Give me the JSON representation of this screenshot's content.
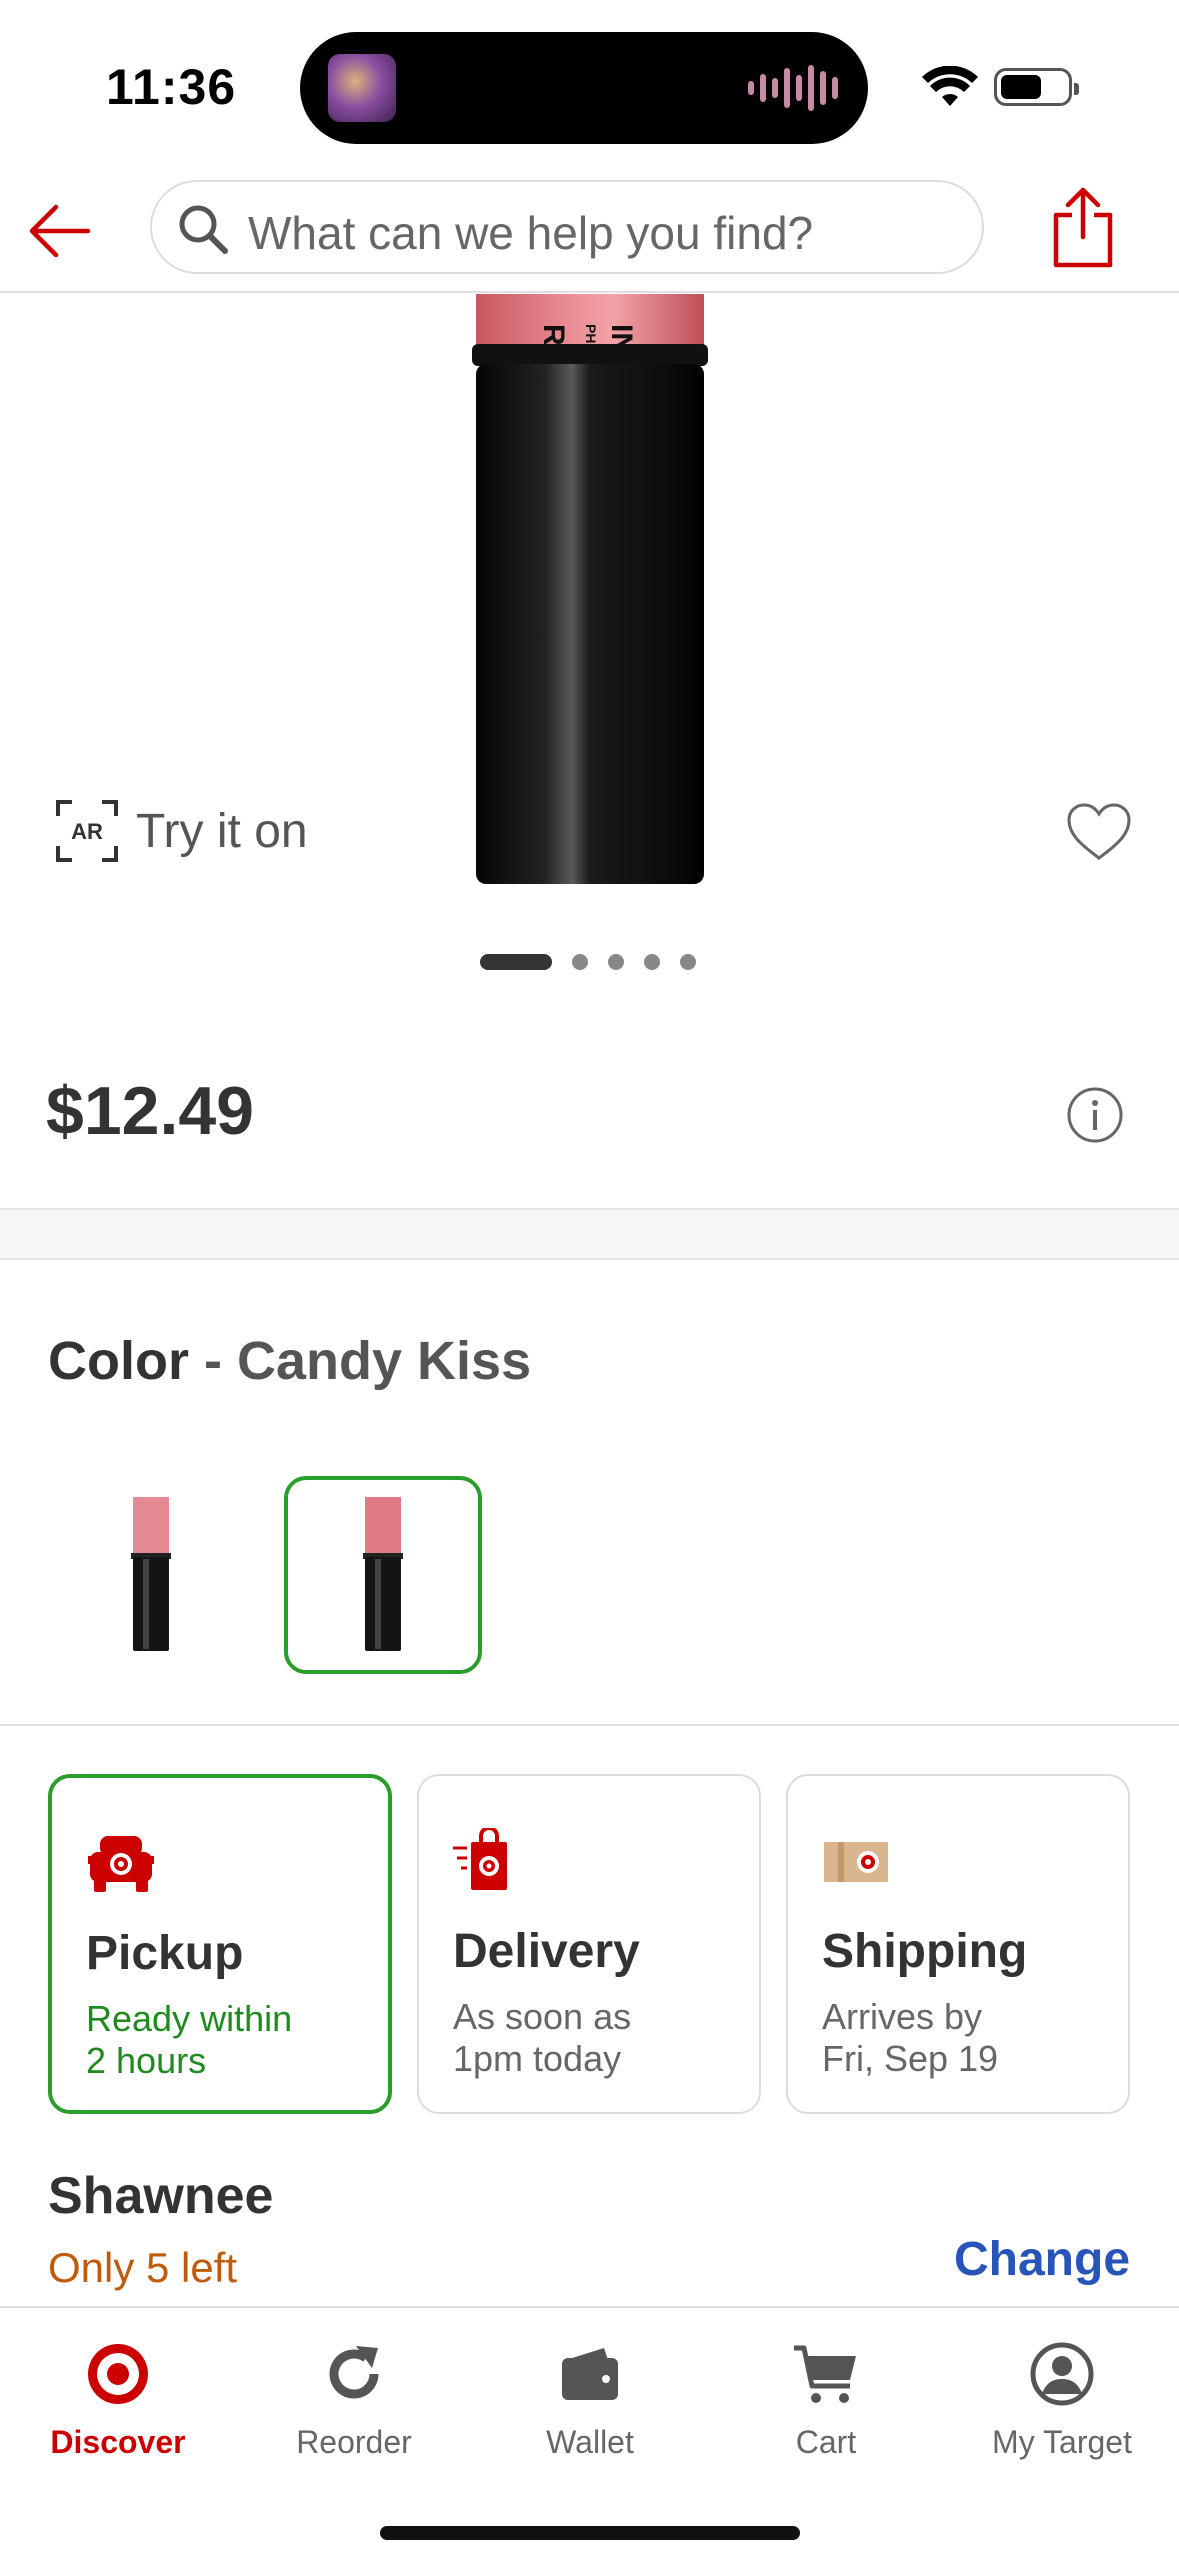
{
  "status_bar": {
    "time": "11:36"
  },
  "header": {
    "search_placeholder": "What can we help you find?",
    "back_icon": "back-arrow-icon",
    "share_icon": "share-icon"
  },
  "product": {
    "try_on_label": "Try it on",
    "image_count": 5,
    "active_image_index": 0,
    "price": "$12.49"
  },
  "color": {
    "label": "Color",
    "separator": "-",
    "selected_name": "Candy Kiss",
    "selected_index": 1,
    "swatch_count": 2
  },
  "fulfillment": [
    {
      "title": "Pickup",
      "line1": "Ready within",
      "line2": "2 hours",
      "icon": "pickup-car-icon",
      "selected": true
    },
    {
      "title": "Delivery",
      "line1": "As soon as",
      "line2": "1pm today",
      "icon": "delivery-bag-icon",
      "selected": false
    },
    {
      "title": "Shipping",
      "line1": "Arrives by",
      "line2": "Fri, Sep 19",
      "icon": "shipping-box-icon",
      "selected": false
    }
  ],
  "store": {
    "name": "Shawnee",
    "stock": "Only 5 left",
    "change_label": "Change"
  },
  "tabs": [
    {
      "label": "Discover",
      "icon": "target-logo-icon",
      "active": true
    },
    {
      "label": "Reorder",
      "icon": "reorder-icon",
      "active": false
    },
    {
      "label": "Wallet",
      "icon": "wallet-icon",
      "active": false
    },
    {
      "label": "Cart",
      "icon": "cart-icon",
      "active": false
    },
    {
      "label": "My Target",
      "icon": "account-icon",
      "active": false
    }
  ],
  "colors": {
    "brand_red": "#cc0000",
    "selected_green": "#2a9d2a",
    "stock_orange": "#c05a0c",
    "link_blue": "#2654b8"
  }
}
